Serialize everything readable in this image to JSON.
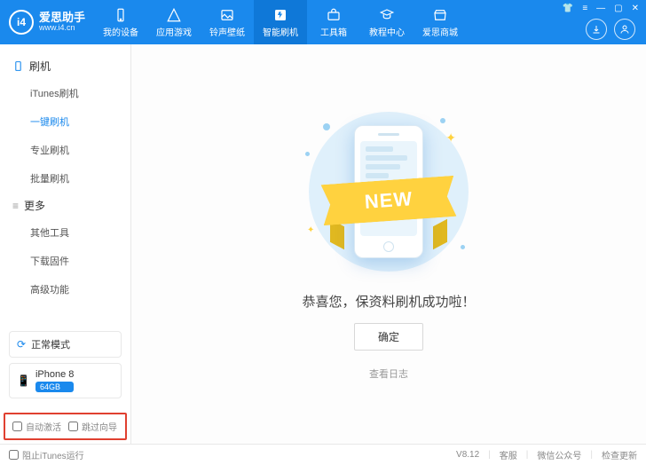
{
  "branding": {
    "logo_text": "i4",
    "app_name": "爱思助手",
    "url": "www.i4.cn"
  },
  "topnav": {
    "items": [
      {
        "label": "我的设备"
      },
      {
        "label": "应用游戏"
      },
      {
        "label": "铃声壁纸"
      },
      {
        "label": "智能刷机"
      },
      {
        "label": "工具箱"
      },
      {
        "label": "教程中心"
      },
      {
        "label": "爱思商城"
      }
    ],
    "active_index": 3
  },
  "sidebar": {
    "groups": [
      {
        "label": "刷机",
        "items": [
          "iTunes刷机",
          "一键刷机",
          "专业刷机",
          "批量刷机"
        ],
        "active_index": 1
      },
      {
        "label": "更多",
        "items": [
          "其他工具",
          "下载固件",
          "高级功能"
        ],
        "active_index": -1
      }
    ]
  },
  "mode_box": {
    "label": "正常模式"
  },
  "device_box": {
    "name": "iPhone 8",
    "storage": "64GB"
  },
  "options": {
    "auto_activate": "自动激活",
    "skip_guide": "跳过向导"
  },
  "main": {
    "ribbon": "NEW",
    "message": "恭喜您，保资料刷机成功啦！",
    "confirm": "确定",
    "view_logs": "查看日志"
  },
  "footer": {
    "block_itunes": "阻止iTunes运行",
    "version": "V8.12",
    "support": "客服",
    "wechat": "微信公众号",
    "check_update": "检查更新"
  }
}
